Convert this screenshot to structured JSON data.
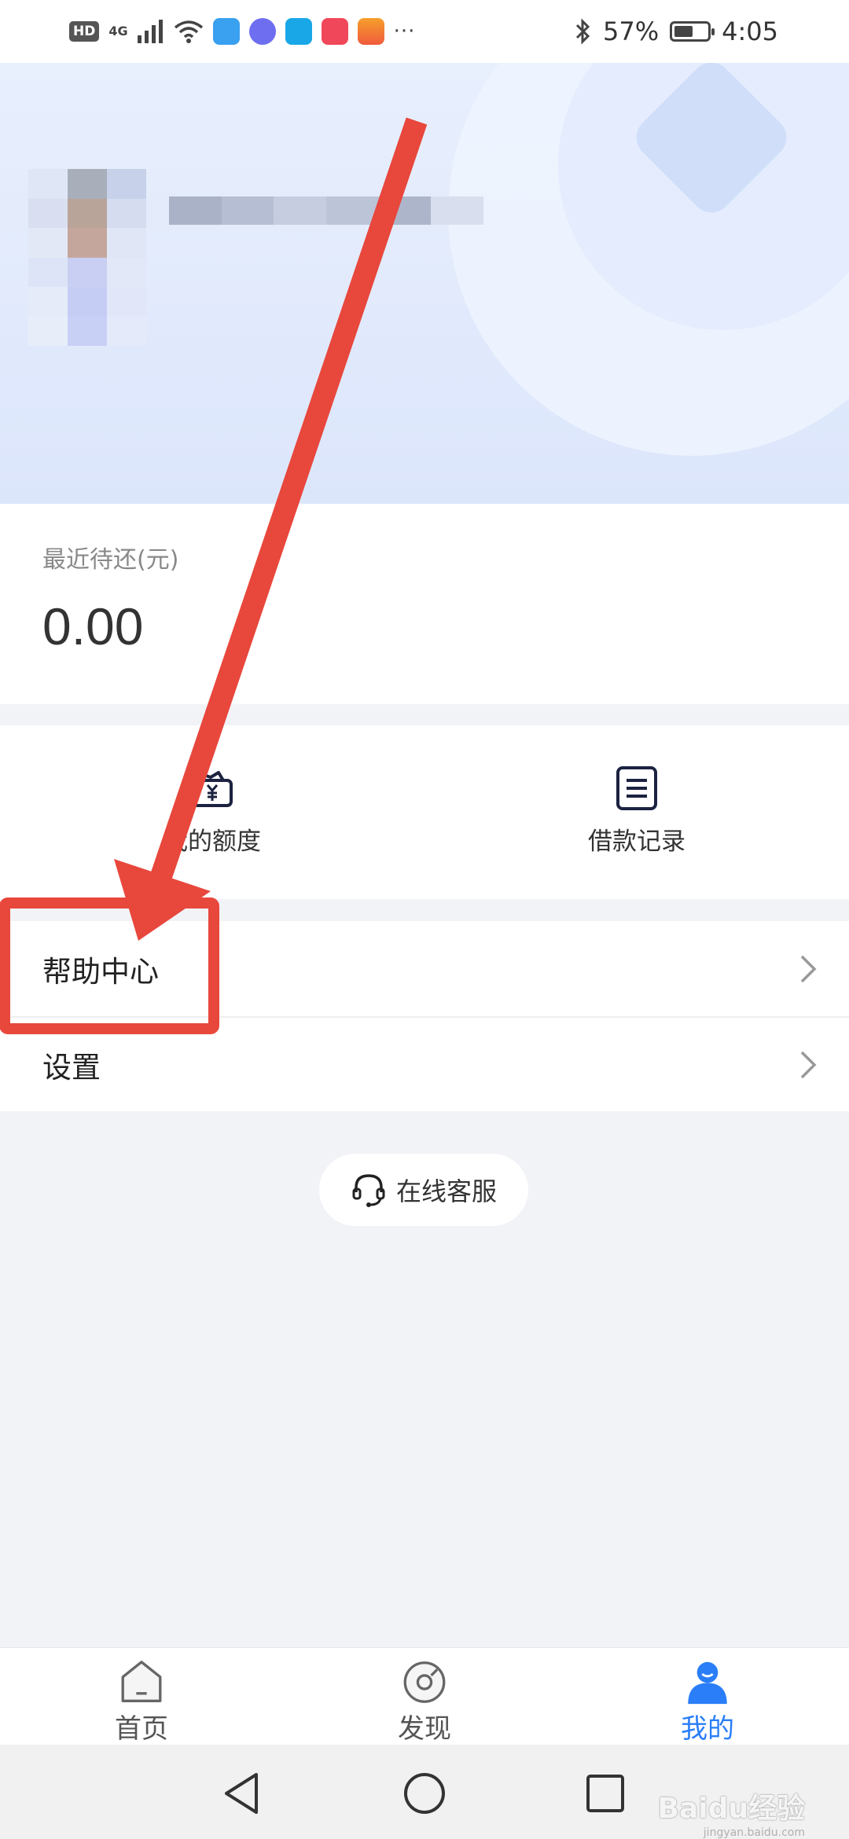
{
  "status_bar": {
    "hd": "HD",
    "network": "4G",
    "more": "···",
    "battery_percent_text": "57%",
    "battery_level": 0.57,
    "time": "4:05",
    "app_icons": [
      "qq-icon",
      "music-icon",
      "search-app-icon",
      "huawei-app-icon",
      "gallery-app-icon"
    ]
  },
  "repayment": {
    "label": "最近待还(元)",
    "amount": "0.00"
  },
  "actions": [
    {
      "icon": "wallet-yuan-icon",
      "label": "我的额度"
    },
    {
      "icon": "document-list-icon",
      "label": "借款记录"
    }
  ],
  "menu": [
    {
      "label": "帮助中心"
    },
    {
      "label": "设置"
    }
  ],
  "service": {
    "label": "在线客服",
    "icon": "headset-icon"
  },
  "bottom_nav": [
    {
      "label": "首页",
      "icon": "home-icon",
      "active": false
    },
    {
      "label": "发现",
      "icon": "discover-icon",
      "active": false
    },
    {
      "label": "我的",
      "icon": "profile-icon",
      "active": true
    }
  ],
  "watermark": {
    "brand": "Baidu经验",
    "url": "jingyan.baidu.com"
  },
  "colors": {
    "accent": "#2a7ef8",
    "annotation": "#e8473c",
    "page_bg": "#f2f3f7"
  }
}
